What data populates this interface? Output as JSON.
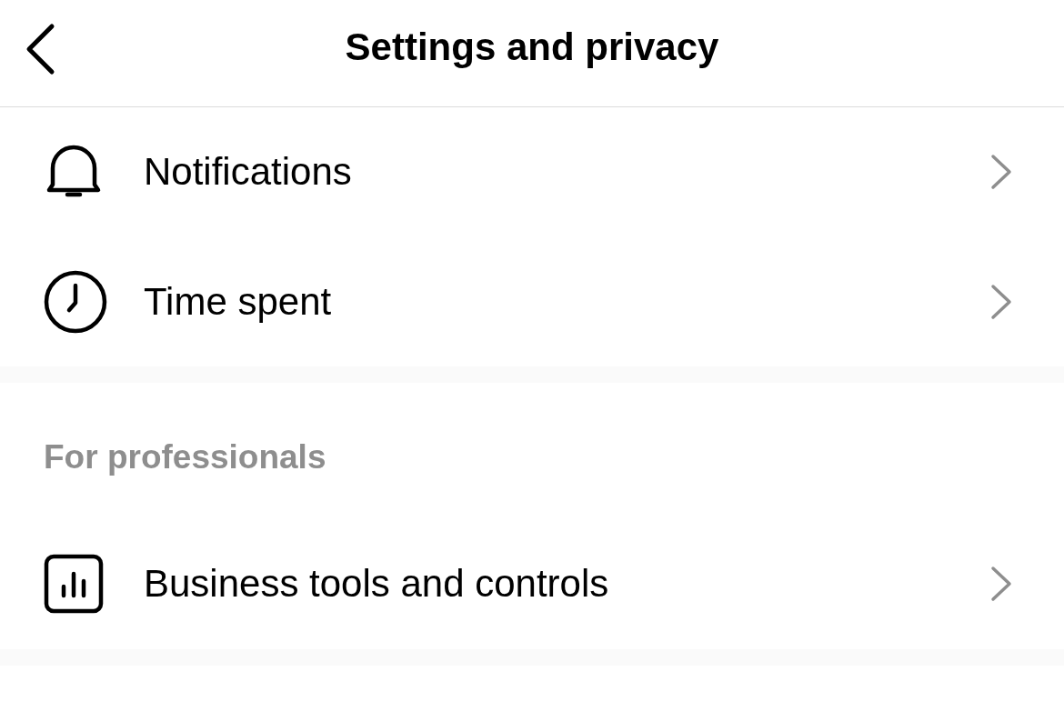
{
  "header": {
    "title": "Settings and privacy"
  },
  "sections": [
    {
      "items": [
        {
          "kind": "bell",
          "label": "Notifications"
        },
        {
          "kind": "clock",
          "label": "Time spent"
        }
      ]
    },
    {
      "title": "For professionals",
      "items": [
        {
          "kind": "chart",
          "label": "Business tools and controls"
        }
      ]
    }
  ]
}
